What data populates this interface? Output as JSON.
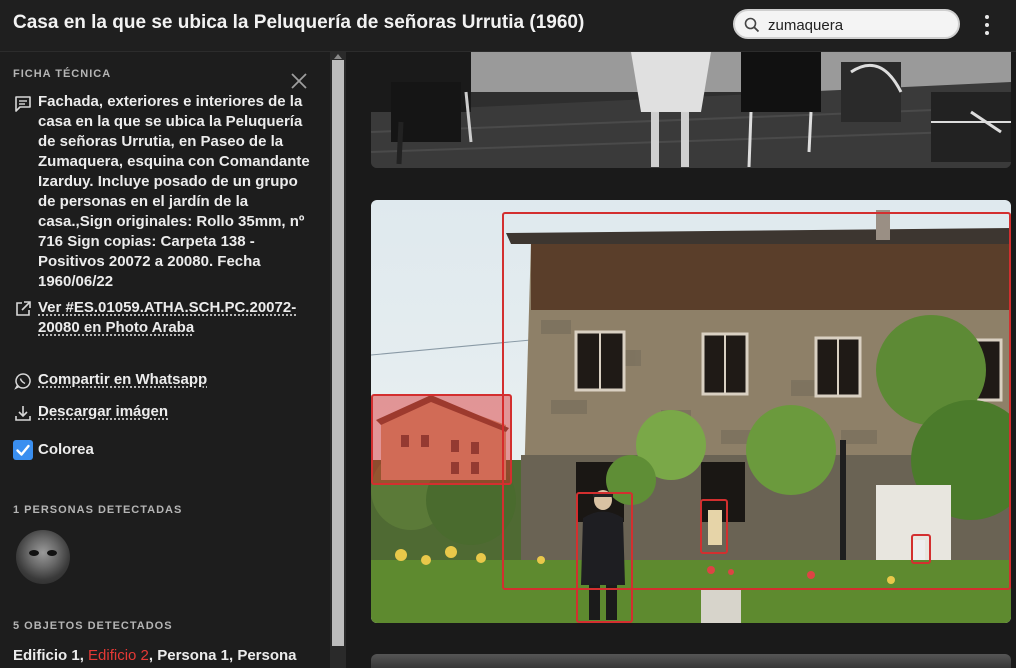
{
  "header": {
    "title": "Casa en la que se ubica la Peluquería de señoras Urrutia (1960)",
    "search_value": "zumaquera"
  },
  "sidebar": {
    "ficha_label": "FICHA TÉCNICA",
    "description": "Fachada, exteriores e interiores de la casa en la que se ubica la Peluquería de señoras Urrutia, en Paseo de la Zumaquera, esquina con Comandante Izarduy. Incluye posado de un grupo de personas en el jardín de la casa.,Sign originales: Rollo 35mm, nº 716 Sign copias: Carpeta 138 - Positivos 20072 a 20080. Fecha 1960/06/22",
    "view_link": "Ver #ES.01059.ATHA.SCH.PC.20072-20080 en Photo Araba",
    "whatsapp_link": "Compartir en Whatsapp",
    "download_link": "Descargar imágen",
    "colorea_label": "Colorea",
    "colorea_checked": true,
    "persons_label": "1 PERSONAS DETECTADAS",
    "objects_label": "5 OBJETOS DETECTADOS",
    "objects": [
      "Edificio 1",
      "Edificio 2",
      "Persona 1",
      "Persona"
    ],
    "objects_highlighted_index": 1
  },
  "colors": {
    "accent_red": "#d32f2f",
    "checkbox_blue": "#3a8ff0",
    "background": "#1c1c1c"
  },
  "icons": [
    "search-icon",
    "more-vert-icon",
    "close-icon",
    "comment-icon",
    "external-link-icon",
    "whatsapp-icon",
    "download-icon",
    "checkbox-icon"
  ]
}
